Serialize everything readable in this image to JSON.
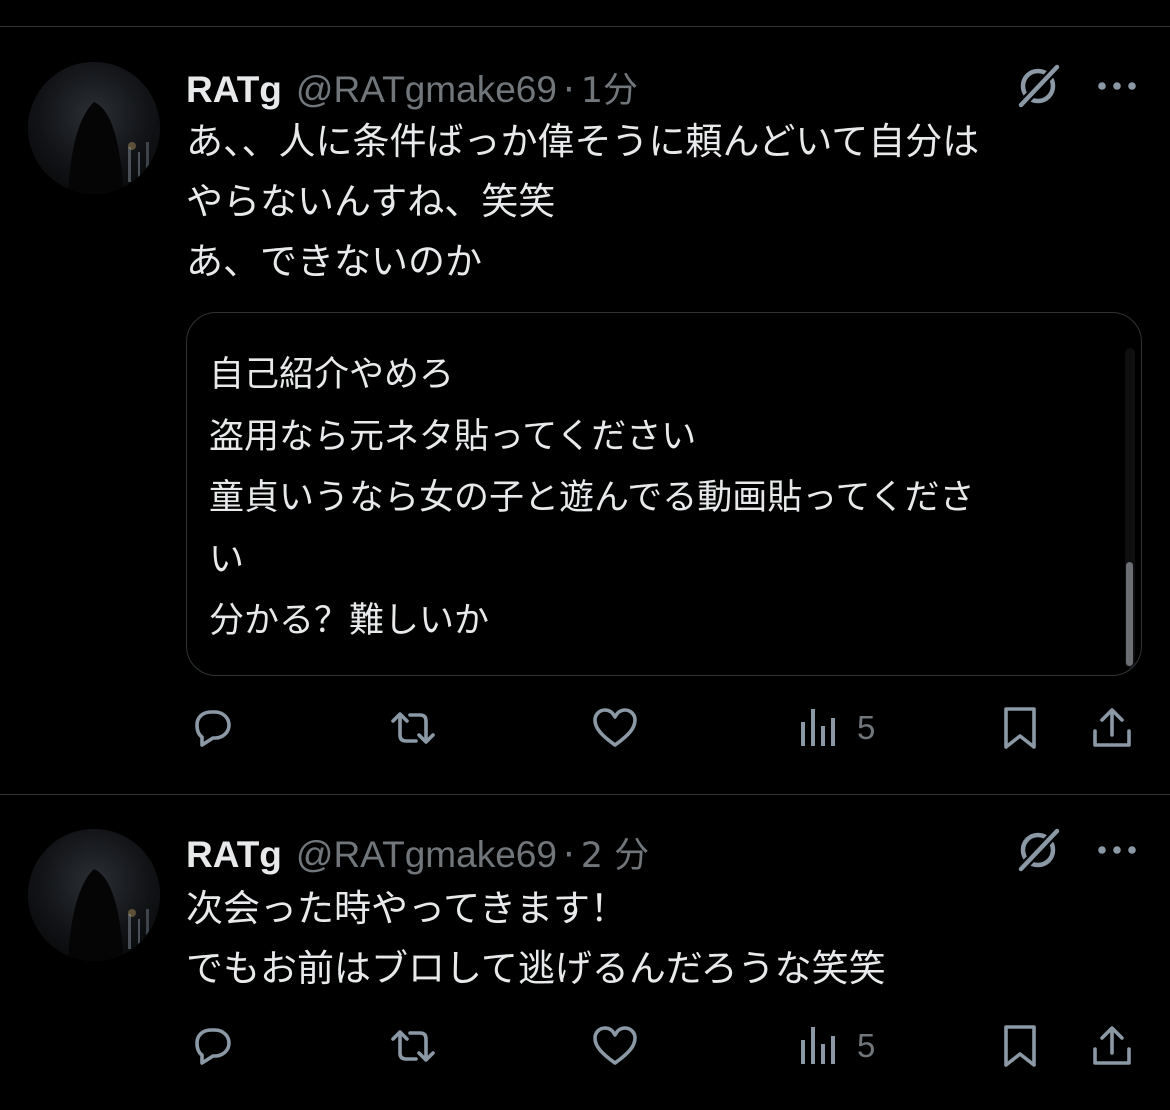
{
  "tweets": [
    {
      "display_name": "RATg",
      "handle": "@RATgmake69",
      "separator": "·",
      "time": "1分",
      "lines": [
        "あ、、人に条件ばっか偉そうに頼んどいて自分は",
        "やらないんすね、笑笑",
        "あ、できないのか"
      ],
      "quote_lines": [
        "自己紹介やめろ",
        "盗用なら元ネタ貼ってください",
        "童貞いうなら女の子と遊んでる動画貼ってくださ",
        "い",
        "分かる？難しいか"
      ],
      "views": "5",
      "icons": {
        "reply": "reply-icon",
        "retweet": "retweet-icon",
        "like": "heart-icon",
        "views": "views-icon",
        "bookmark": "bookmark-icon",
        "share": "share-icon",
        "grok": "grok-icon",
        "more": "more-icon"
      }
    },
    {
      "display_name": "RATg",
      "handle": "@RATgmake69",
      "separator": "·",
      "time": "2 分",
      "lines": [
        "次会った時やってきます！",
        "でもお前はブロして逃げるんだろうな笑笑"
      ],
      "views": "5"
    }
  ],
  "colors": {
    "background": "#000000",
    "text": "#e7e9ea",
    "secondary": "#71767b",
    "icon": "#8b98a5",
    "border": "#2f3336"
  }
}
